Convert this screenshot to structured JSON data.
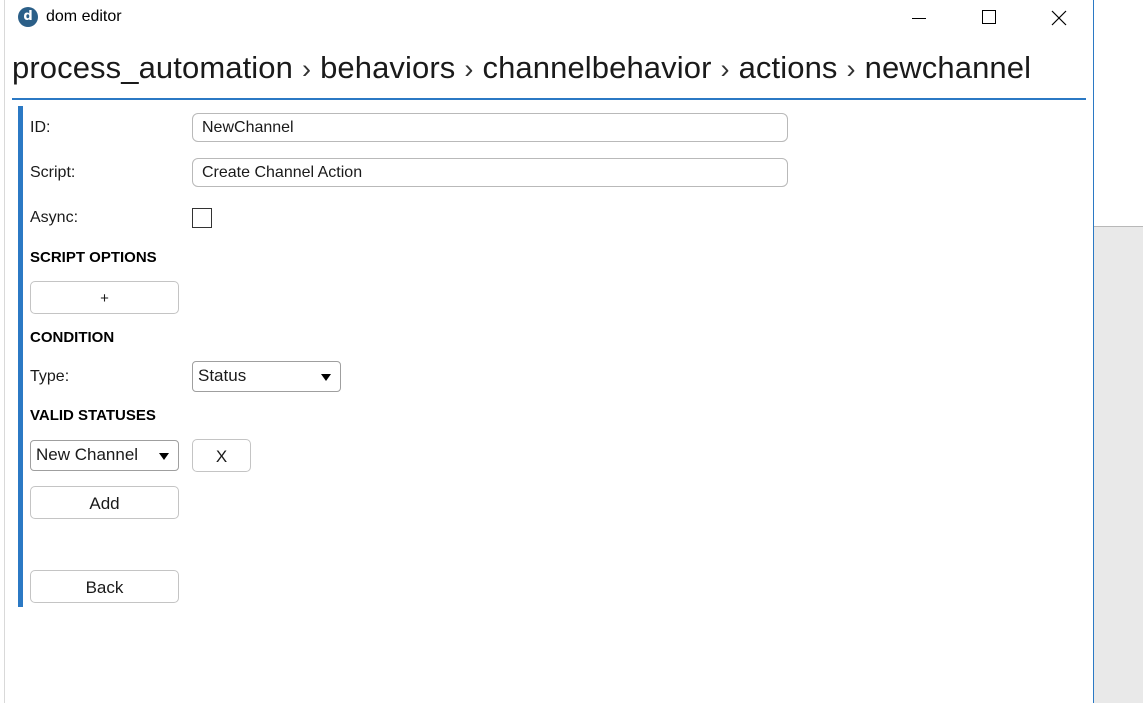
{
  "window": {
    "app_icon_letter": "d",
    "title": "dom editor"
  },
  "breadcrumb": [
    "process_automation",
    "behaviors",
    "channelbehavior",
    "actions",
    "newchannel"
  ],
  "breadcrumb_separator": "›",
  "form": {
    "id_label": "ID:",
    "id_value": "NewChannel",
    "script_label": "Script:",
    "script_value": "Create Channel Action",
    "async_label": "Async:",
    "async_checked": false,
    "script_options_heading": "SCRIPT OPTIONS",
    "add_option_label": "+",
    "condition_heading": "CONDITION",
    "type_label": "Type:",
    "type_value": "Status",
    "valid_statuses_heading": "VALID STATUSES",
    "status_value": "New Channel",
    "remove_status_label": "X",
    "add_label": "Add",
    "back_label": "Back"
  },
  "colors": {
    "accent": "#2b79c4",
    "logo": "#2b5f88"
  }
}
